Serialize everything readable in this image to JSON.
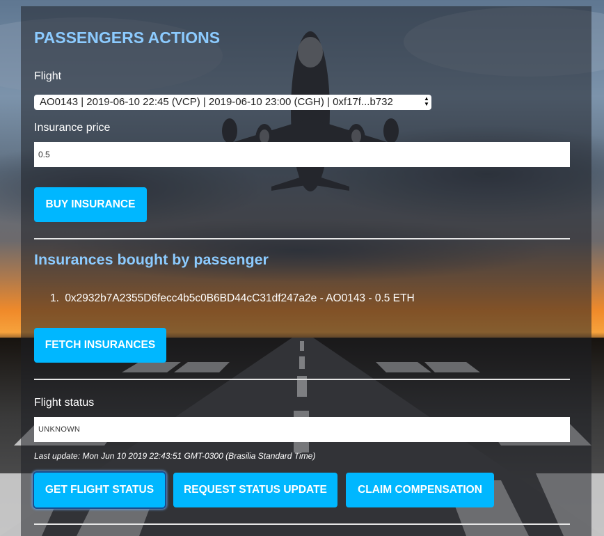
{
  "section_title": "PASSENGERS ACTIONS",
  "flight": {
    "label": "Flight",
    "selected": "AO0143 | 2019-06-10 22:45 (VCP) | 2019-06-10 23:00 (CGH) | 0xf17f...b732"
  },
  "insurance_price": {
    "label": "Insurance price",
    "value": "0.5"
  },
  "buy_button": "BUY INSURANCE",
  "insurances": {
    "title": "Insurances bought by passenger",
    "items": [
      {
        "index": "1.",
        "text": "0x2932b7A2355D6fecc4b5c0B6BD44cC31df247a2e - AO0143 - 0.5 ETH"
      }
    ],
    "fetch_button": "FETCH INSURANCES"
  },
  "flight_status": {
    "label": "Flight status",
    "value": "UNKNOWN",
    "last_update": "Last update: Mon Jun 10 2019 22:43:51 GMT-0300 (Brasilia Standard Time)"
  },
  "actions": {
    "get_status": "GET FLIGHT STATUS",
    "request_update": "REQUEST STATUS UPDATE",
    "claim": "CLAIM COMPENSATION"
  },
  "colors": {
    "heading": "#8ccbff",
    "button": "#00b7ff",
    "panel": "rgba(28,30,36,0.52)"
  },
  "icons": {
    "select_arrows": "up-down-arrows"
  }
}
